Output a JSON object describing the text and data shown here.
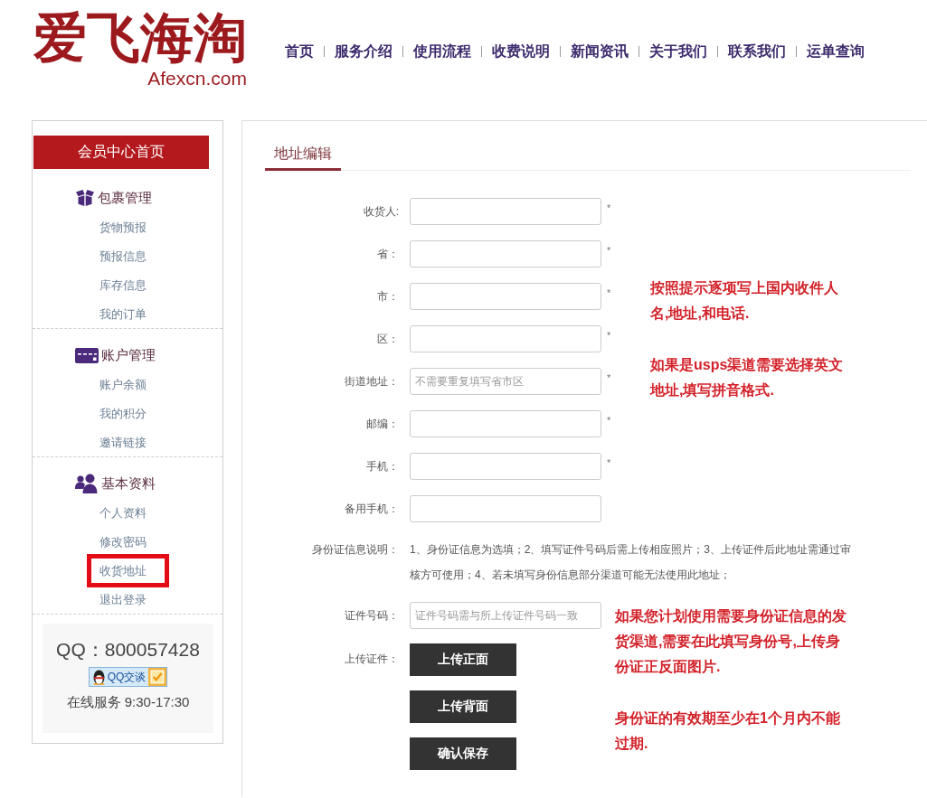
{
  "header": {
    "logo": "爱飞海淘",
    "domain": "Afexcn.com",
    "nav": [
      "首页",
      "服务介绍",
      "使用流程",
      "收费说明",
      "新闻资讯",
      "关于我们",
      "联系我们",
      "运单查询"
    ]
  },
  "sidebar": {
    "home_button": "会员中心首页",
    "sections": [
      {
        "kind": "package",
        "title": "包裹管理",
        "items": [
          {
            "label": "货物预报",
            "highlighted": false
          },
          {
            "label": "预报信息",
            "highlighted": false
          },
          {
            "label": "库存信息",
            "highlighted": false
          },
          {
            "label": "我的订单",
            "highlighted": false
          }
        ]
      },
      {
        "kind": "card",
        "title": "账户管理",
        "items": [
          {
            "label": "账户余额",
            "highlighted": false
          },
          {
            "label": "我的积分",
            "highlighted": false
          },
          {
            "label": "邀请链接",
            "highlighted": false
          }
        ]
      },
      {
        "kind": "users",
        "title": "基本资料",
        "items": [
          {
            "label": "个人资料",
            "highlighted": false
          },
          {
            "label": "修改密码",
            "highlighted": false
          },
          {
            "label": "收货地址",
            "highlighted": true
          },
          {
            "label": "退出登录",
            "highlighted": false
          }
        ]
      }
    ],
    "contact": {
      "qq": "QQ：800057428",
      "chat_button": "QQ交谈",
      "hours": "在线服务 9:30-17:30"
    }
  },
  "main": {
    "tabs": [
      {
        "label": "地址编辑",
        "selected": true
      }
    ],
    "fields": [
      {
        "label": "收货人:",
        "required_mark": "*"
      },
      {
        "label": "省：",
        "required_mark": "*"
      },
      {
        "label": "市：",
        "required_mark": "*"
      },
      {
        "label": "区：",
        "required_mark": "*"
      },
      {
        "label": "街道地址：",
        "placeholder": "不需要重复填写省市区",
        "required_mark": "*"
      },
      {
        "label": "邮编：",
        "required_mark": "*"
      },
      {
        "label": "手机：",
        "required_mark": "*"
      },
      {
        "label": "备用手机："
      }
    ],
    "id_note": {
      "label": "身份证信息说明：",
      "lines": [
        "1、身份证信息为选填；2、填写证件号码后需上传相应照片；3、上传证件后此地址需通过审",
        "核方可使用；4、若未填写身份信息部分渠道可能无法使用此地址；"
      ]
    },
    "id_field": {
      "label": "证件号码：",
      "placeholder": "证件号码需与所上传证件号码一致"
    },
    "upload": {
      "label": "上传证件：",
      "buttons": [
        "上传正面",
        "上传背面"
      ]
    },
    "save_button": "确认保存"
  },
  "annotations": [
    {
      "lines": [
        "按照提示逐项写上国内收件人",
        "名,地址,和电话."
      ]
    },
    {
      "lines": [
        "如果是usps渠道需要选择英文",
        "地址,填写拼音格式."
      ]
    },
    {
      "lines": [
        "如果您计划使用需要身份证信息的发",
        "货渠道,需要在此填写身份号,上传身",
        "份证正反面图片."
      ]
    },
    {
      "lines": [
        "身份证的有效期至少在1个月内不能",
        "过期."
      ]
    }
  ]
}
